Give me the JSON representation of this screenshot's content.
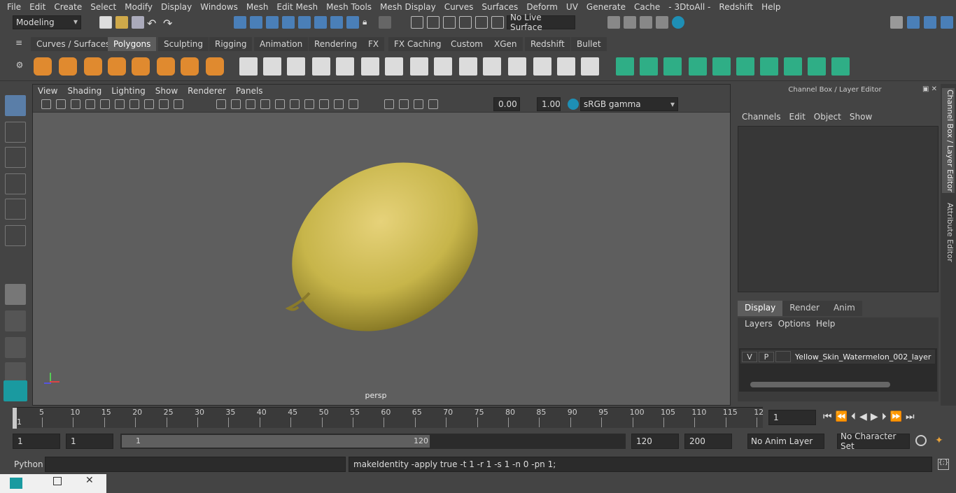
{
  "menus": [
    "File",
    "Edit",
    "Create",
    "Select",
    "Modify",
    "Display",
    "Windows",
    "Mesh",
    "Edit Mesh",
    "Mesh Tools",
    "Mesh Display",
    "Curves",
    "Surfaces",
    "Deform",
    "UV",
    "Generate",
    "Cache",
    "- 3DtoAll -",
    "Redshift",
    "Help"
  ],
  "workspace_mode": "Modeling",
  "live_surface": "No Live Surface",
  "shelf_tabs": [
    "Curves / Surfaces",
    "Polygons",
    "Sculpting",
    "Rigging",
    "Animation",
    "Rendering",
    "FX",
    "FX Caching",
    "Custom",
    "XGen",
    "Redshift",
    "Bullet"
  ],
  "active_shelf_tab": "Polygons",
  "viewport": {
    "menus": [
      "View",
      "Shading",
      "Lighting",
      "Show",
      "Renderer",
      "Panels"
    ],
    "exposure": "0.00",
    "gamma": "1.00",
    "color_space": "sRGB gamma",
    "camera_label": "persp"
  },
  "channel_box": {
    "title": "Channel Box / Layer Editor",
    "menus": [
      "Channels",
      "Edit",
      "Object",
      "Show"
    ]
  },
  "layer_editor": {
    "tabs": [
      "Display",
      "Render",
      "Anim"
    ],
    "active_tab": "Display",
    "menus": [
      "Layers",
      "Options",
      "Help"
    ],
    "layer": {
      "v": "V",
      "p": "P",
      "name": "Yellow_Skin_Watermelon_002_layer"
    }
  },
  "side_tabs": [
    "Channel Box / Layer Editor",
    "Attribute Editor"
  ],
  "timeline": {
    "ticks": [
      "5",
      "10",
      "15",
      "20",
      "25",
      "30",
      "35",
      "40",
      "45",
      "50",
      "55",
      "60",
      "65",
      "70",
      "75",
      "80",
      "85",
      "90",
      "95",
      "100",
      "105",
      "110",
      "115",
      "12"
    ],
    "start_marker": "1",
    "current_frame": "1"
  },
  "range": {
    "start": "1",
    "playback_start": "1",
    "slider_start": "1",
    "slider_end": "120",
    "playback_end": "120",
    "end": "200",
    "anim_layer": "No Anim Layer",
    "character_set": "No Character Set"
  },
  "command": {
    "language": "Python",
    "result": "makeIdentity -apply true -t 1 -r 1 -s 1 -n 0 -pn 1;"
  }
}
